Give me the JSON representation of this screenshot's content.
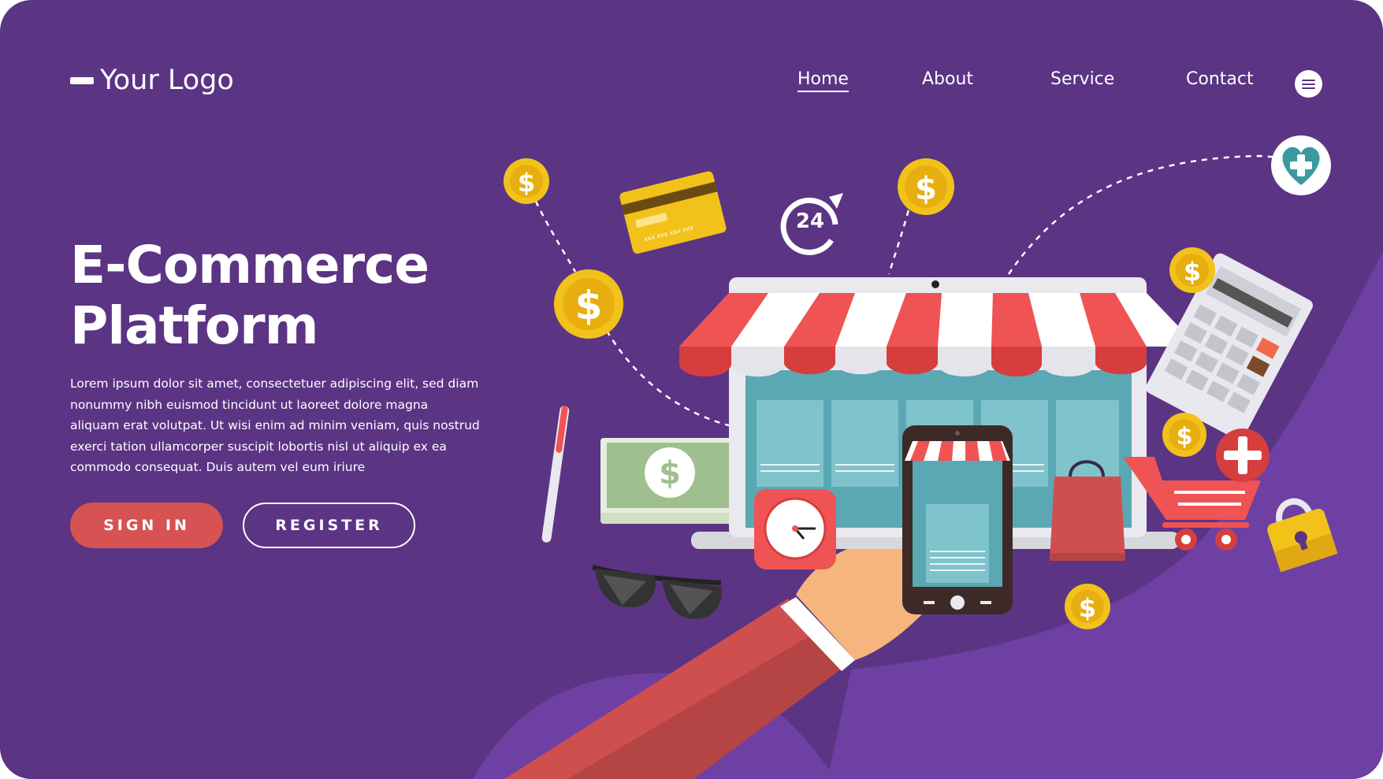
{
  "header": {
    "logo_text": "Your Logo",
    "nav": [
      {
        "label": "Home",
        "active": true
      },
      {
        "label": "About",
        "active": false
      },
      {
        "label": "Service",
        "active": false
      },
      {
        "label": "Contact",
        "active": false
      }
    ],
    "menu_icon": "hamburger-menu-icon"
  },
  "hero": {
    "title_line1": "E-Commerce",
    "title_line2": "Platform",
    "body": "Lorem ipsum dolor sit amet, consectetuer adipiscing elit, sed diam nonummy nibh euismod tincidunt ut laoreet dolore magna aliquam erat volutpat. Ut wisi enim ad minim veniam, quis nostrud exerci tation ullamcorper suscipit lobortis nisl ut aliquip ex ea commodo consequat. Duis autem vel eum iriure",
    "signin_label": "SIGN IN",
    "register_label": "REGISTER"
  },
  "illustration": {
    "coin_symbol": "$",
    "clock_24_label": "24",
    "card_number": "xxx xxx xxx xxx",
    "icons": [
      "dollar-coin-icon",
      "credit-card-icon",
      "24-hour-icon",
      "heart-plus-icon",
      "laptop-storefront-icon",
      "calculator-icon",
      "shopping-cart-icon",
      "padlock-icon",
      "shopping-bag-icon",
      "smartphone-icon",
      "alarm-clock-icon",
      "banknote-stack-icon",
      "sunglasses-icon",
      "lipstick-pen-icon",
      "hand-icon"
    ]
  },
  "colors": {
    "background": "#5b3484",
    "accent_wave": "#7040a0",
    "primary_button": "#d65253",
    "text": "#ffffff",
    "coin": "#f2c21b",
    "awning_red": "#ef5353",
    "screen_teal": "#5aa8b4"
  }
}
